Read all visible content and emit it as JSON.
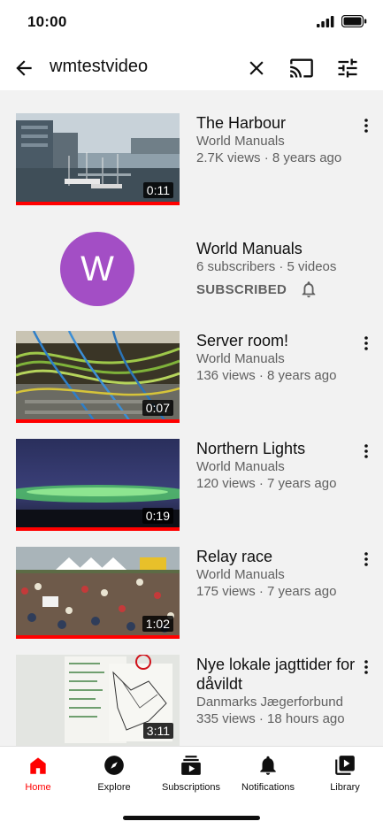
{
  "status": {
    "time": "10:00"
  },
  "search": {
    "query": "wmtestvideo"
  },
  "results": [
    {
      "type": "video",
      "title": "The Harbour",
      "channel": "World Manuals",
      "stats": "2.7K views · 8 years ago",
      "duration": "0:11",
      "thumb_icon": "harbour-thumbnail"
    },
    {
      "type": "channel",
      "avatar_letter": "W",
      "name": "World Manuals",
      "stats": "6 subscribers · 5 videos",
      "subscribed_label": "SUBSCRIBED"
    },
    {
      "type": "video",
      "title": "Server room!",
      "channel": "World Manuals",
      "stats": "136 views · 8 years ago",
      "duration": "0:07",
      "thumb_icon": "server-cables-thumbnail"
    },
    {
      "type": "video",
      "title": "Northern Lights",
      "channel": "World Manuals",
      "stats": "120 views · 7 years ago",
      "duration": "0:19",
      "thumb_icon": "aurora-thumbnail"
    },
    {
      "type": "video",
      "title": "Relay race",
      "channel": "World Manuals",
      "stats": "175 views · 7 years ago",
      "duration": "1:02",
      "thumb_icon": "crowd-thumbnail"
    },
    {
      "type": "video",
      "title": "Nye lokale jagttider for dåvildt",
      "channel": "Danmarks Jægerforbund",
      "stats": "335 views · 18 hours ago",
      "duration": "3:11",
      "thumb_icon": "map-board-thumbnail"
    }
  ],
  "nav": [
    {
      "label": "Home",
      "icon": "home-icon",
      "active": true
    },
    {
      "label": "Explore",
      "icon": "compass-icon",
      "active": false
    },
    {
      "label": "Subscriptions",
      "icon": "subscriptions-icon",
      "active": false
    },
    {
      "label": "Notifications",
      "icon": "bell-icon",
      "active": false
    },
    {
      "label": "Library",
      "icon": "library-icon",
      "active": false
    }
  ],
  "colors": {
    "accent": "#ff0000",
    "avatar": "#a34ec5",
    "text_secondary": "#606060"
  }
}
